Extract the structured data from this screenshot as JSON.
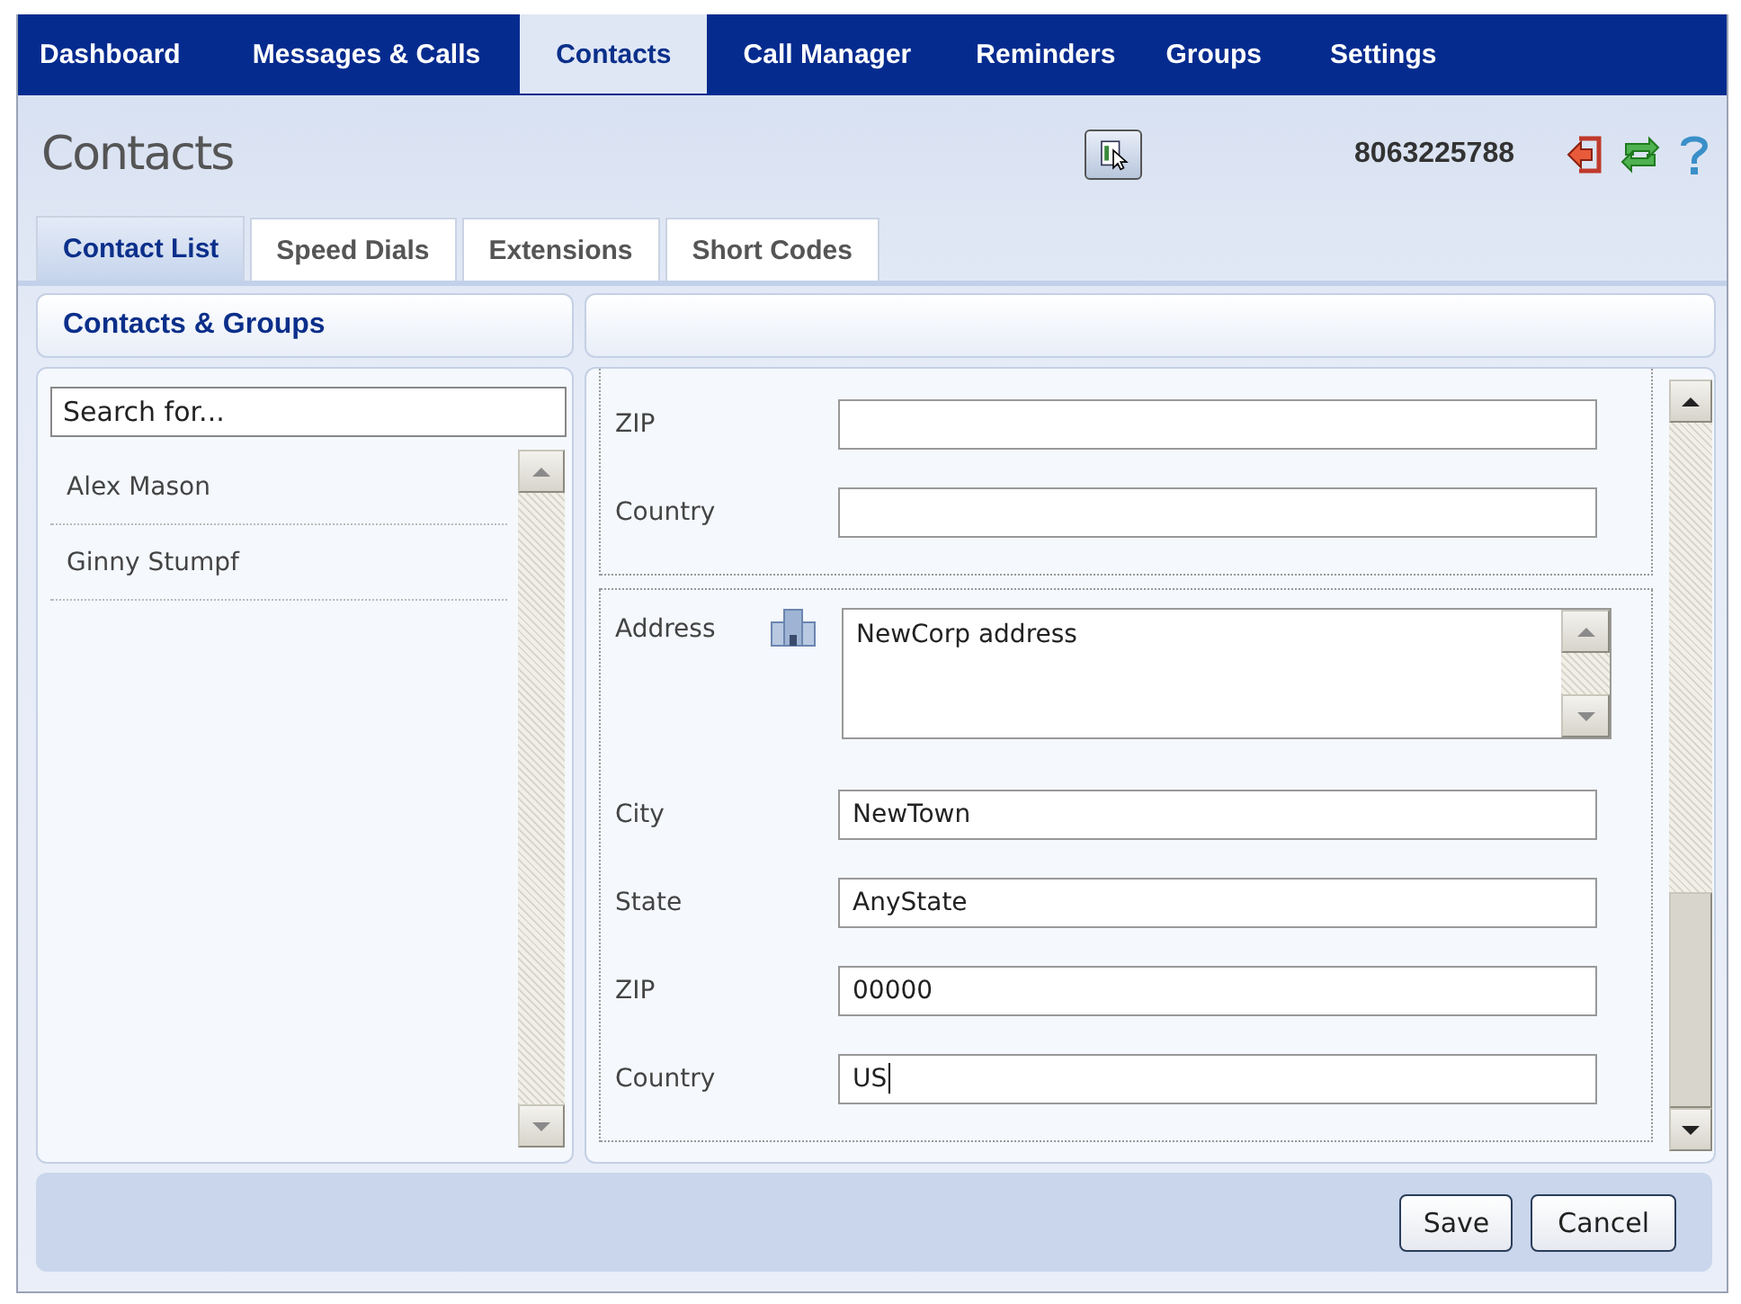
{
  "nav": {
    "tabs": [
      {
        "label": "Dashboard",
        "selected": false
      },
      {
        "label": "Messages & Calls",
        "selected": false
      },
      {
        "label": "Contacts",
        "selected": true
      },
      {
        "label": "Call Manager",
        "selected": false
      },
      {
        "label": "Reminders",
        "selected": false
      },
      {
        "label": "Groups",
        "selected": false
      },
      {
        "label": "Settings",
        "selected": false
      }
    ]
  },
  "header": {
    "title": "Contacts",
    "phone": "8063225788"
  },
  "subtabs": [
    {
      "label": "Contact List",
      "selected": true
    },
    {
      "label": "Speed Dials",
      "selected": false
    },
    {
      "label": "Extensions",
      "selected": false
    },
    {
      "label": "Short Codes",
      "selected": false
    }
  ],
  "contacts_panel": {
    "title": "Contacts & Groups",
    "search": {
      "placeholder": "Search for..."
    },
    "contacts": [
      {
        "name": "Alex Mason"
      },
      {
        "name": "Ginny Stumpf"
      }
    ]
  },
  "form": {
    "sections": [
      {
        "fields": [
          {
            "kind": "text",
            "label": "ZIP"
          },
          {
            "kind": "text",
            "label": "Country"
          }
        ]
      },
      {
        "fields": [
          {
            "kind": "address",
            "label": "Address",
            "value": "NewCorp address"
          },
          {
            "kind": "text",
            "label": "City",
            "value": "NewTown"
          },
          {
            "kind": "text",
            "label": "State",
            "value": "AnyState"
          },
          {
            "kind": "text",
            "label": "ZIP",
            "value": "00000"
          },
          {
            "kind": "text",
            "label": "Country",
            "value": "US",
            "focused": true
          }
        ]
      }
    ]
  },
  "buttons": [
    {
      "label": "Save"
    },
    {
      "label": "Cancel"
    }
  ]
}
